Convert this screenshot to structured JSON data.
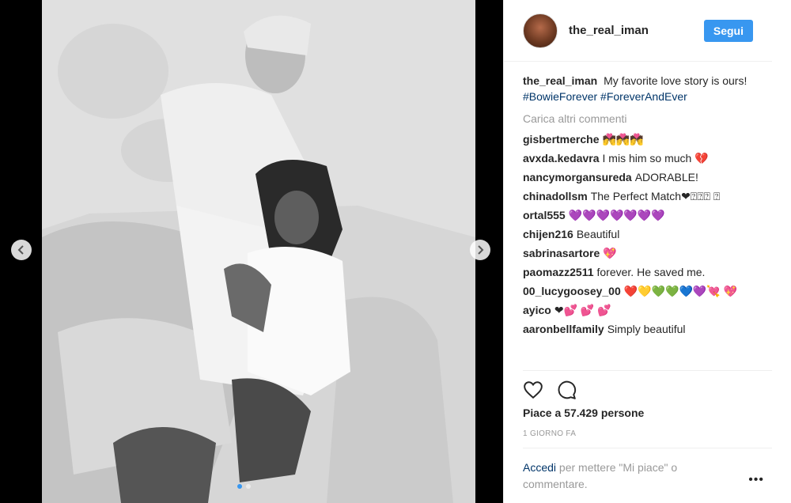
{
  "post": {
    "username": "the_real_iman",
    "follow_label": "Segui"
  },
  "caption": {
    "username": "the_real_iman",
    "text": "My favorite love story is ours!",
    "hashtag1": "#BowieForever",
    "hashtag2": "#ForeverAndEver"
  },
  "load_more_label": "Carica altri commenti",
  "comments": [
    {
      "user": "gisbertmerche",
      "text": "💏💏💏"
    },
    {
      "user": "avxda.kedavra",
      "text": "I mis him so much 💔"
    },
    {
      "user": "nancymorgansureda",
      "text": "ADORABLE!"
    },
    {
      "user": "chinadollsm",
      "text": "The Perfect Match❤⍰⍰⍰ ⍰"
    },
    {
      "user": "ortal555",
      "text": "💜💜💜💜💜💜💜"
    },
    {
      "user": "chijen216",
      "text": "Beautiful"
    },
    {
      "user": "sabrinasartore",
      "text": "💖"
    },
    {
      "user": "paomazz2511",
      "text": "forever. He saved me."
    },
    {
      "user": "00_lucygoosey_00",
      "text": "❤️💛💚💚💙💜💘 💖"
    },
    {
      "user": "ayico",
      "text": "❤💕 💕 💕"
    },
    {
      "user": "aaronbellfamily",
      "text": "Simply beautiful"
    }
  ],
  "likes_label": "Piace a 57.429 persone",
  "timestamp": "1 GIORNO FA",
  "login": {
    "link": "Accedi",
    "text": "per mettere \"Mi piace\" o commentare."
  },
  "more_label": "•••",
  "icons": {
    "prev": "chevron-left-icon",
    "next": "chevron-right-icon",
    "like": "heart-icon",
    "comment": "comment-icon"
  },
  "colors": {
    "accent": "#3897f0",
    "link": "#003569"
  }
}
